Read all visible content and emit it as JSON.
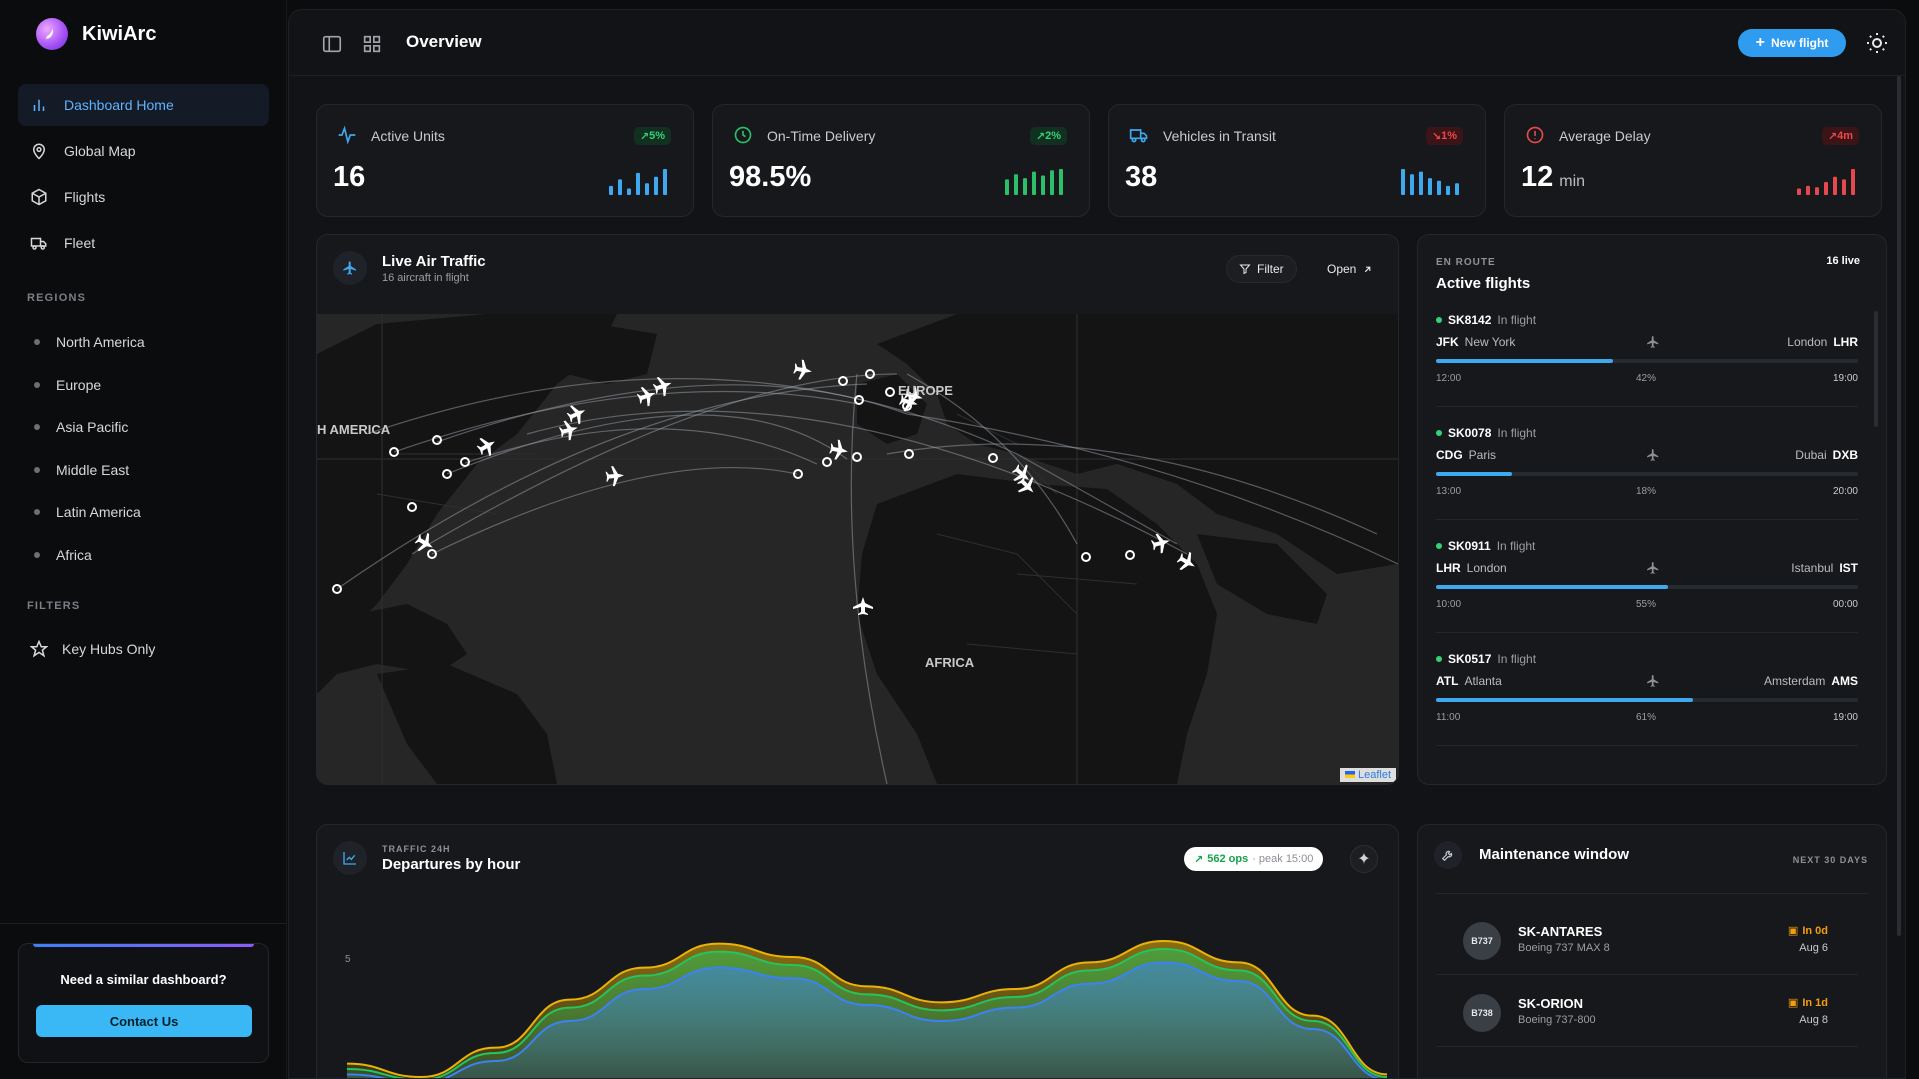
{
  "brand": {
    "name": "KiwiArc"
  },
  "nav": [
    {
      "label": "Dashboard Home",
      "icon": "bar-chart-icon",
      "active": true
    },
    {
      "label": "Global Map",
      "icon": "map-pin-icon"
    },
    {
      "label": "Flights",
      "icon": "box-icon"
    },
    {
      "label": "Fleet",
      "icon": "truck-icon"
    }
  ],
  "regions_label": "REGIONS",
  "regions": [
    "North America",
    "Europe",
    "Asia Pacific",
    "Middle East",
    "Latin America",
    "Africa"
  ],
  "filters_label": "FILTERS",
  "filter_item": "Key Hubs Only",
  "promo": {
    "title": "Need a similar dashboard?",
    "button": "Contact Us"
  },
  "header": {
    "title": "Overview",
    "new_flight": "New flight"
  },
  "kpis": [
    {
      "label": "Active Units",
      "value": "16",
      "unit": "",
      "badge": "5%",
      "trend": "up",
      "color": "#3fa9ef",
      "spark": [
        0.35,
        0.6,
        0.25,
        0.85,
        0.45,
        0.7,
        1.0
      ]
    },
    {
      "label": "On-Time Delivery",
      "value": "98.5%",
      "unit": "",
      "badge": "2%",
      "trend": "up",
      "color": "#2bbf6a",
      "spark": [
        0.6,
        0.8,
        0.65,
        0.9,
        0.75,
        0.95,
        1.0
      ]
    },
    {
      "label": "Vehicles in Transit",
      "value": "38",
      "unit": "",
      "badge": "1%",
      "trend": "down",
      "color": "#3fa9ef",
      "spark": [
        1.0,
        0.8,
        0.9,
        0.65,
        0.55,
        0.35,
        0.45
      ]
    },
    {
      "label": "Average Delay",
      "value": "12",
      "unit": "min",
      "badge": "4m",
      "trend": "up-bad",
      "color": "#e5484d",
      "spark": [
        0.25,
        0.35,
        0.3,
        0.5,
        0.7,
        0.6,
        1.0
      ]
    }
  ],
  "traffic": {
    "title": "Live Air Traffic",
    "subtitle": "16 aircraft in flight",
    "filter": "Filter",
    "open": "Open",
    "attribution": "Leaflet"
  },
  "map_labels": {
    "america": "H AMERICA",
    "europe": "EUROPE",
    "africa": "AFRICA"
  },
  "active": {
    "section": "EN ROUTE",
    "title": "Active flights",
    "live": "16 live",
    "flights": [
      {
        "id": "SK8142",
        "status": "In flight",
        "from_code": "JFK",
        "from_city": "New York",
        "to_city": "London",
        "to_code": "LHR",
        "dep": "12:00",
        "progress": 42,
        "pct": "42%",
        "arr": "19:00"
      },
      {
        "id": "SK0078",
        "status": "In flight",
        "from_code": "CDG",
        "from_city": "Paris",
        "to_city": "Dubai",
        "to_code": "DXB",
        "dep": "13:00",
        "progress": 18,
        "pct": "18%",
        "arr": "20:00"
      },
      {
        "id": "SK0911",
        "status": "In flight",
        "from_code": "LHR",
        "from_city": "London",
        "to_city": "Istanbul",
        "to_code": "IST",
        "dep": "10:00",
        "progress": 55,
        "pct": "55%",
        "arr": "00:00"
      },
      {
        "id": "SK0517",
        "status": "In flight",
        "from_code": "ATL",
        "from_city": "Atlanta",
        "to_city": "Amsterdam",
        "to_code": "AMS",
        "dep": "11:00",
        "progress": 61,
        "pct": "61%",
        "arr": "19:00"
      }
    ]
  },
  "departures": {
    "section": "TRAFFIC 24H",
    "title": "Departures by hour",
    "ops": "562 ops",
    "peak": "· peak 15:00",
    "ytick": "5"
  },
  "chart_data": {
    "type": "area",
    "title": "Departures by hour",
    "ytick": "5",
    "series": [
      {
        "color": "#eab308",
        "values": [
          0.8,
          0.3,
          1.4,
          3.2,
          4.4,
          5.3,
          4.8,
          3.7,
          3.1,
          3.6,
          4.6,
          5.4,
          4.6,
          2.6,
          0.4
        ]
      },
      {
        "color": "#22c55e",
        "values": [
          0.6,
          0.2,
          1.2,
          2.9,
          4.1,
          5.0,
          4.5,
          3.4,
          2.8,
          3.3,
          4.3,
          5.1,
          4.3,
          2.4,
          0.3
        ]
      },
      {
        "color": "#3b82f6",
        "values": [
          0.4,
          0.1,
          0.9,
          2.4,
          3.6,
          4.4,
          4.0,
          3.0,
          2.4,
          2.9,
          3.8,
          4.6,
          3.9,
          2.1,
          0.2
        ]
      }
    ]
  },
  "maintenance": {
    "title": "Maintenance window",
    "next": "NEXT 30 DAYS",
    "items": [
      {
        "avatar": "B737",
        "name": "SK-ANTARES",
        "model": "Boeing 737 MAX 8",
        "in": "In 0d",
        "date": "Aug 6"
      },
      {
        "avatar": "B738",
        "name": "SK-ORION",
        "model": "Boeing 737-800",
        "in": "In 1d",
        "date": "Aug 8"
      }
    ]
  }
}
